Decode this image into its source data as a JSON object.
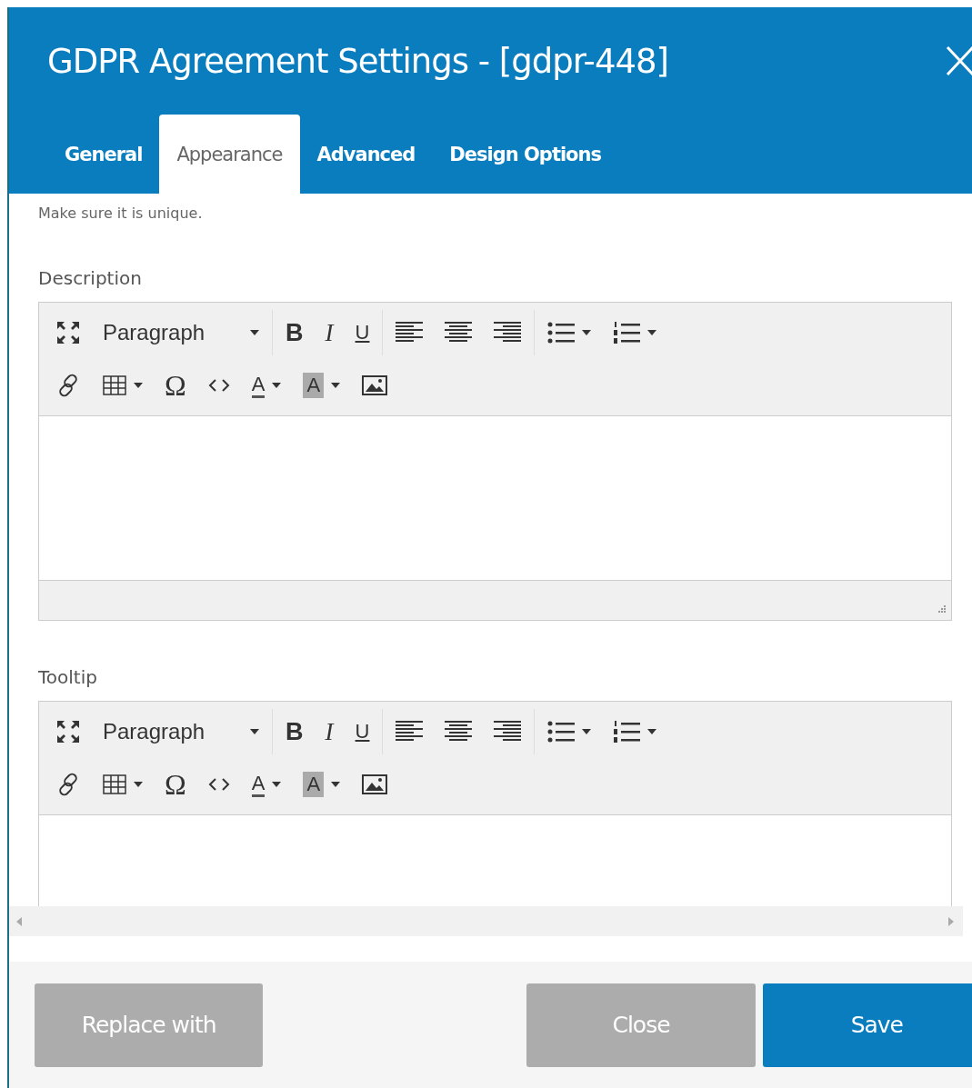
{
  "window": {
    "title": "GDPR Agreement Settings - [gdpr-448]"
  },
  "tabs": [
    {
      "label": "General",
      "selected": false
    },
    {
      "label": "Appearance",
      "selected": true
    },
    {
      "label": "Advanced",
      "selected": false
    },
    {
      "label": "Design Options",
      "selected": false
    }
  ],
  "hint": "Make sure it is unique.",
  "editors": [
    {
      "label": "Description",
      "toolbar": [
        [
          {
            "kind": "fullscreen"
          },
          {
            "kind": "format",
            "label": "Paragraph"
          },
          {
            "kind": "sep"
          },
          {
            "kind": "bold",
            "glyph": "B"
          },
          {
            "kind": "italic",
            "glyph": "I"
          },
          {
            "kind": "underline",
            "glyph": "U"
          },
          {
            "kind": "sep"
          },
          {
            "kind": "align-left"
          },
          {
            "kind": "align-center"
          },
          {
            "kind": "align-right"
          },
          {
            "kind": "sep"
          },
          {
            "kind": "bullet-list"
          },
          {
            "kind": "numbered-list"
          }
        ],
        [
          {
            "kind": "link"
          },
          {
            "kind": "table"
          },
          {
            "kind": "special",
            "glyph": "Ω"
          },
          {
            "kind": "code"
          },
          {
            "kind": "text-color",
            "glyph": "A"
          },
          {
            "kind": "bg-color",
            "glyph": "A"
          },
          {
            "kind": "image"
          }
        ]
      ],
      "statusbar": true
    },
    {
      "label": "Tooltip",
      "toolbar": [
        [
          {
            "kind": "fullscreen"
          },
          {
            "kind": "format",
            "label": "Paragraph"
          },
          {
            "kind": "sep"
          },
          {
            "kind": "bold",
            "glyph": "B"
          },
          {
            "kind": "italic",
            "glyph": "I"
          },
          {
            "kind": "underline",
            "glyph": "U"
          },
          {
            "kind": "sep"
          },
          {
            "kind": "align-left"
          },
          {
            "kind": "align-center"
          },
          {
            "kind": "align-right"
          },
          {
            "kind": "sep"
          },
          {
            "kind": "bullet-list"
          },
          {
            "kind": "numbered-list"
          }
        ],
        [
          {
            "kind": "link"
          },
          {
            "kind": "table"
          },
          {
            "kind": "special",
            "glyph": "Ω"
          },
          {
            "kind": "code"
          },
          {
            "kind": "text-color",
            "glyph": "A"
          },
          {
            "kind": "bg-color",
            "glyph": "A"
          },
          {
            "kind": "image"
          }
        ]
      ]
    }
  ],
  "buttons": [
    {
      "label": "Replace with",
      "kind": "secondary"
    },
    {
      "label": "Close",
      "kind": "secondary"
    },
    {
      "label": "Save",
      "kind": "primary"
    }
  ]
}
